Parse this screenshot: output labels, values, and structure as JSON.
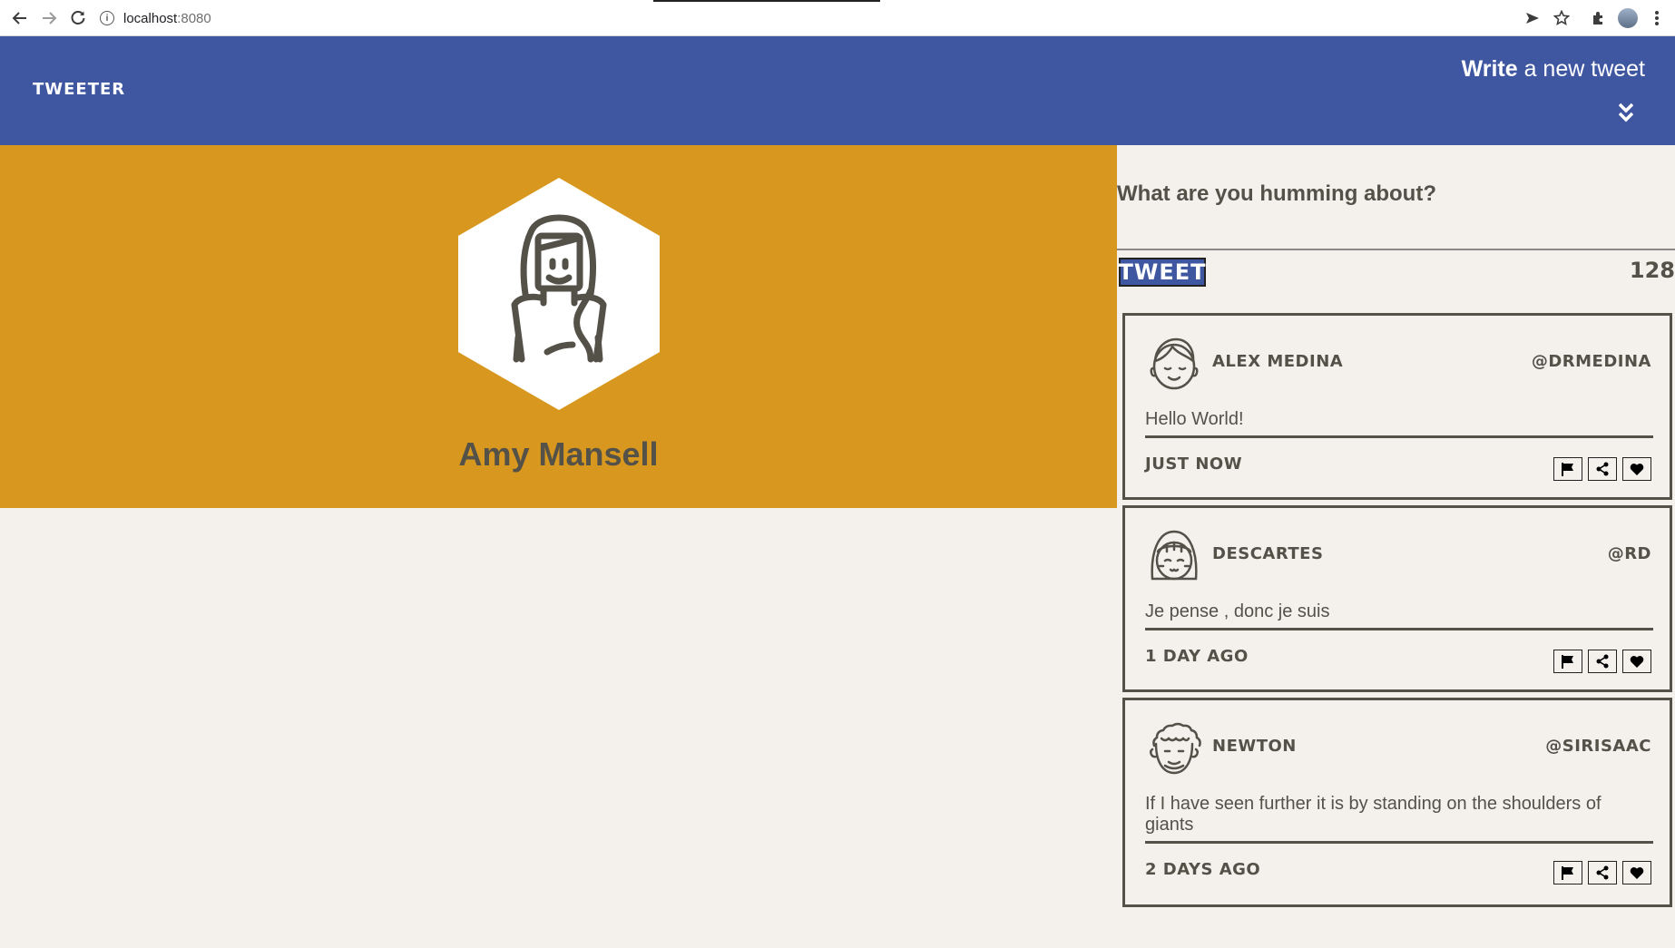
{
  "browser": {
    "url_host": "localhost",
    "url_port": ":8080"
  },
  "nav": {
    "brand": "TWEETER",
    "compose_bold": "Write",
    "compose_rest": " a new tweet"
  },
  "profile": {
    "name": "Amy Mansell"
  },
  "compose": {
    "placeholder": "What are you humming about?",
    "button_label": "TWEET",
    "counter": "128"
  },
  "colors": {
    "nav_bg": "#3f56a1",
    "profile_bg": "#d8981f",
    "page_bg": "#f4f1ec",
    "text": "#545149"
  },
  "tweets": [
    {
      "name": "ALEX MEDINA",
      "handle": "@DRMEDINA",
      "text": "Hello World!",
      "time": "JUST NOW",
      "avatar": "smiling-man-avatar-icon"
    },
    {
      "name": "DESCARTES",
      "handle": "@RD",
      "text": "Je pense , donc je suis",
      "time": "1 DAY AGO",
      "avatar": "bangs-girl-avatar-icon"
    },
    {
      "name": "NEWTON",
      "handle": "@SIRISAAC",
      "text": "If I have seen further it is by standing on the shoulders of giants",
      "time": "2 DAYS AGO",
      "avatar": "curly-hair-avatar-icon"
    }
  ],
  "tweet_actions": [
    "flag-icon",
    "share-icon",
    "heart-icon"
  ]
}
